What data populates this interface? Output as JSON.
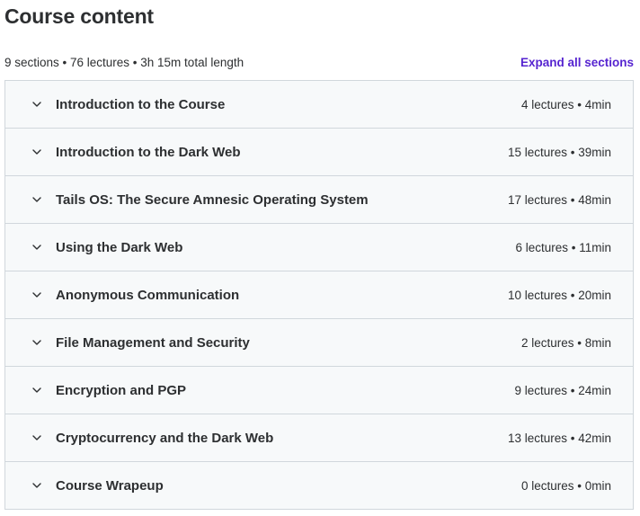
{
  "header": {
    "title": "Course content",
    "summary": "9 sections • 76 lectures • 3h 15m total length",
    "expand_label": "Expand all sections"
  },
  "sections": [
    {
      "title": "Introduction to the Course",
      "meta": "4 lectures • 4min"
    },
    {
      "title": "Introduction to the Dark Web",
      "meta": "15 lectures • 39min"
    },
    {
      "title": "Tails OS: The Secure Amnesic Operating System",
      "meta": "17 lectures • 48min"
    },
    {
      "title": "Using the Dark Web",
      "meta": "6 lectures • 11min"
    },
    {
      "title": "Anonymous Communication",
      "meta": "10 lectures • 20min"
    },
    {
      "title": "File Management and Security",
      "meta": "2 lectures • 8min"
    },
    {
      "title": "Encryption and PGP",
      "meta": "9 lectures • 24min"
    },
    {
      "title": "Cryptocurrency and the Dark Web",
      "meta": "13 lectures • 42min"
    },
    {
      "title": "Course Wrapeup",
      "meta": "0 lectures • 0min"
    }
  ],
  "icons": {
    "section_toggle": "chevron-down-icon"
  },
  "colors": {
    "link": "#5624d0",
    "text": "#2d2f31",
    "row_background": "#f7f9fa",
    "border": "#d1d7dc"
  }
}
